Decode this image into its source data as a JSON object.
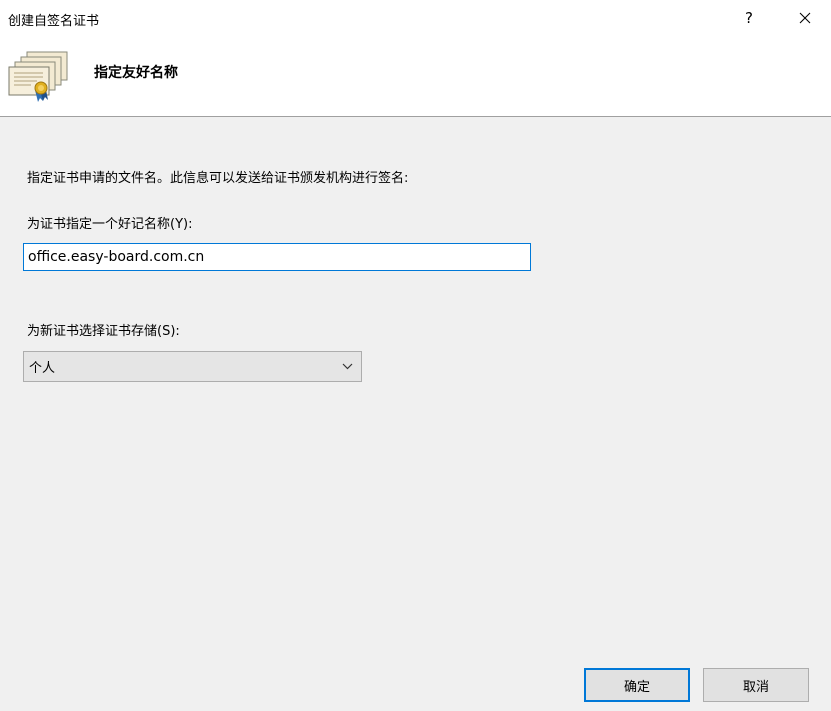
{
  "window": {
    "title": "创建自签名证书",
    "help_label": "?"
  },
  "banner": {
    "icon": "certificate-icon",
    "title": "指定友好名称"
  },
  "content": {
    "description": "指定证书申请的文件名。此信息可以发送给证书颁发机构进行签名:",
    "friendly_name_label": "为证书指定一个好记名称(Y):",
    "friendly_name_value": "office.easy-board.com.cn",
    "store_label": "为新证书选择证书存储(S):",
    "store_selected": "个人"
  },
  "buttons": {
    "ok_label": "确定",
    "cancel_label": "取消"
  },
  "colors": {
    "accent": "#0078d7",
    "content_bg": "#f0f0f0",
    "button_bg": "#e1e1e1"
  }
}
